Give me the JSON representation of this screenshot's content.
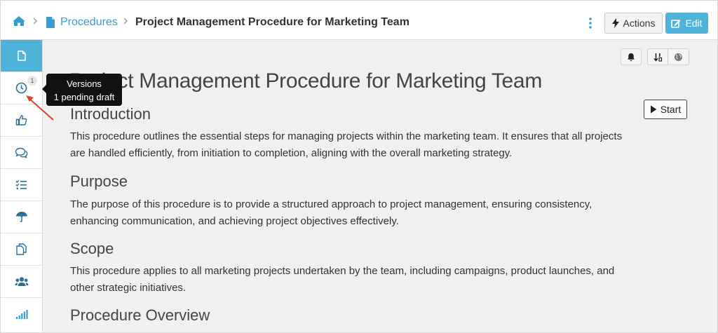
{
  "breadcrumb": {
    "parent": "Procedures",
    "current": "Project Management Procedure for Marketing Team"
  },
  "toolbar": {
    "actions_label": "Actions",
    "edit_label": "Edit"
  },
  "sidebar": {
    "items": [
      {
        "icon": "document-icon",
        "active": true
      },
      {
        "icon": "clock-icon",
        "badge": "1"
      },
      {
        "icon": "thumbs-up-icon"
      },
      {
        "icon": "comments-icon"
      },
      {
        "icon": "checklist-icon"
      },
      {
        "icon": "umbrella-icon"
      },
      {
        "icon": "copy-icon"
      },
      {
        "icon": "users-icon"
      },
      {
        "icon": "signal-bars-icon"
      }
    ]
  },
  "tooltip": {
    "title": "Versions",
    "subtitle": "1 pending draft"
  },
  "content": {
    "title": "Project Management Procedure for Marketing Team",
    "start_label": "Start",
    "sections": [
      {
        "heading": "Introduction",
        "text": "This procedure outlines the essential steps for managing projects within the marketing team. It ensures that all projects are handled efficiently, from initiation to completion, aligning with the overall marketing strategy."
      },
      {
        "heading": "Purpose",
        "text": "The purpose of this procedure is to provide a structured approach to project management, ensuring consistency, enhancing communication, and achieving project objectives effectively."
      },
      {
        "heading": "Scope",
        "text": "This procedure applies to all marketing projects undertaken by the team, including campaigns, product launches, and other strategic initiatives."
      },
      {
        "heading": "Procedure Overview"
      }
    ]
  },
  "colors": {
    "accent": "#4fb3d9",
    "link": "#3a9bd1",
    "tooltip_bg": "#111111",
    "annotation_arrow": "#e0402f"
  }
}
